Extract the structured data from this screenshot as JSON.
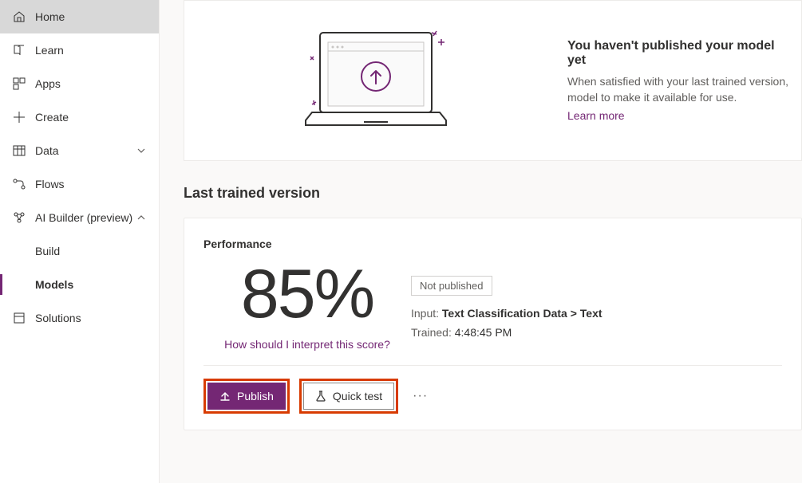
{
  "sidebar": {
    "items": [
      {
        "label": "Home"
      },
      {
        "label": "Learn"
      },
      {
        "label": "Apps"
      },
      {
        "label": "Create"
      },
      {
        "label": "Data"
      },
      {
        "label": "Flows"
      },
      {
        "label": "AI Builder (preview)"
      },
      {
        "label": "Build"
      },
      {
        "label": "Models"
      },
      {
        "label": "Solutions"
      }
    ]
  },
  "publish_panel": {
    "title": "You haven't published your model yet",
    "body": "When satisfied with your last trained version, model to make it available for use.",
    "learn_more": "Learn more"
  },
  "section_title": "Last trained version",
  "performance": {
    "heading": "Performance",
    "score": "85%",
    "interpret": "How should I interpret this score?",
    "status_badge": "Not published",
    "input_label": "Input:",
    "input_source": "Text Classification Data",
    "input_sep": ">",
    "input_field": "Text",
    "trained_label": "Trained:",
    "trained_time": "4:48:45 PM"
  },
  "actions": {
    "publish": "Publish",
    "quick_test": "Quick test"
  }
}
